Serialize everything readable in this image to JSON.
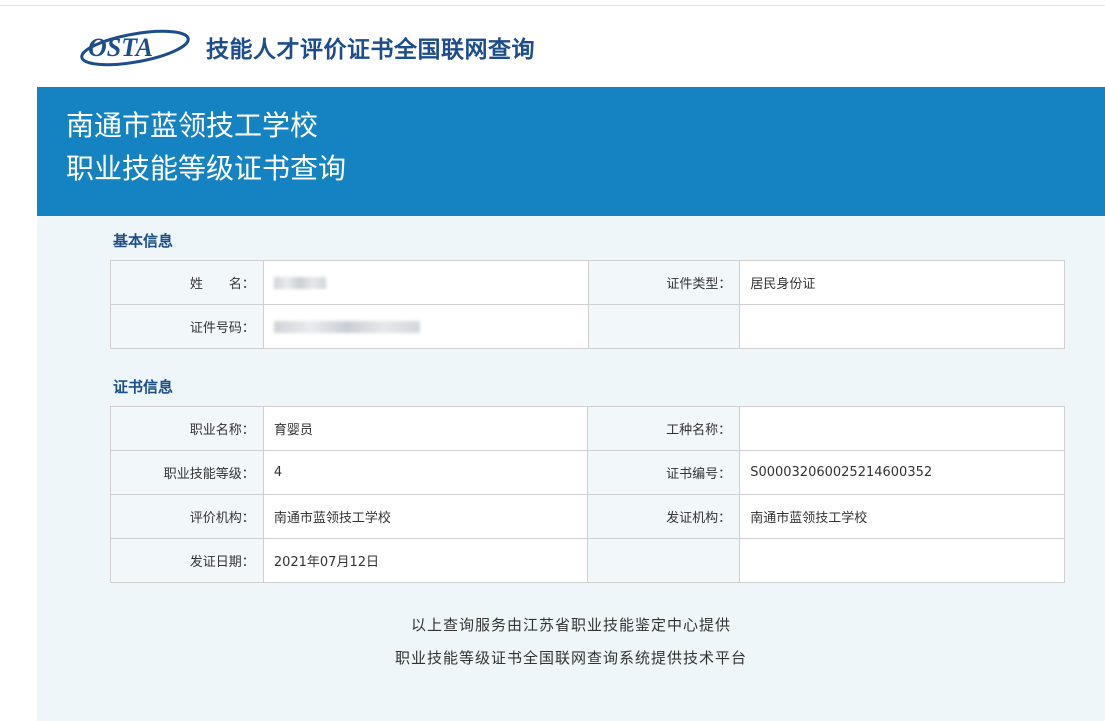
{
  "header": {
    "logo_text": "OSTA",
    "site_title": "技能人才评价证书全国联网查询"
  },
  "banner": {
    "line1": "南通市蓝领技工学校",
    "line2": "职业技能等级证书查询"
  },
  "basic_info": {
    "title": "基本信息",
    "name_label": "姓　　名：",
    "name_value": "[redacted]",
    "id_type_label": "证件类型：",
    "id_type_value": "居民身份证",
    "id_number_label": "证件号码：",
    "id_number_value": "[redacted]"
  },
  "cert_info": {
    "title": "证书信息",
    "occupation_label": "职业名称：",
    "occupation_value": "育婴员",
    "work_type_label": "工种名称：",
    "work_type_value": "",
    "level_label": "职业技能等级：",
    "level_value": "4",
    "cert_no_label": "证书编号：",
    "cert_no_value": "S000032060025214600352",
    "eval_org_label": "评价机构：",
    "eval_org_value": "南通市蓝领技工学校",
    "issue_org_label": "发证机构：",
    "issue_org_value": "南通市蓝领技工学校",
    "issue_date_label": "发证日期：",
    "issue_date_value": "2021年07月12日"
  },
  "footer": {
    "line1": "以上查询服务由江苏省职业技能鉴定中心提供",
    "line2": "职业技能等级证书全国联网查询系统提供技术平台"
  },
  "colors": {
    "banner": "#1583c1",
    "title": "#1e4d8c",
    "content_bg": "#eef6fa"
  }
}
